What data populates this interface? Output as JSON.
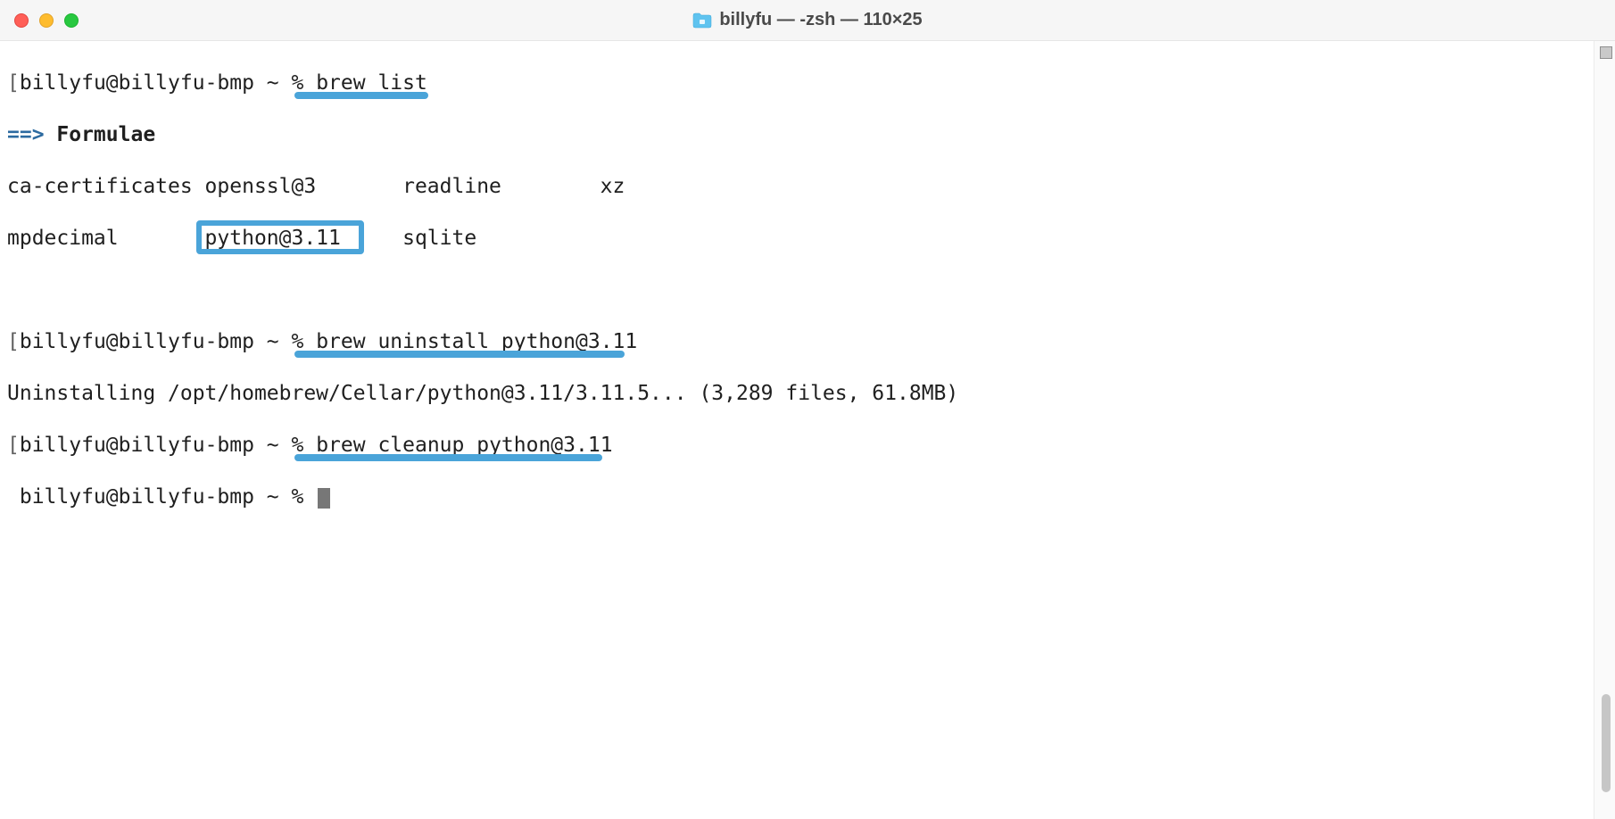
{
  "window": {
    "title": "billyfu — -zsh — 110×25",
    "traffic_lights": {
      "close": "close",
      "minimize": "minimize",
      "zoom": "zoom"
    }
  },
  "terminal": {
    "lines": {
      "l0": {
        "bracket": "[",
        "prompt": "billyfu@billyfu-bmp ~ % ",
        "cmd": "brew list",
        "end": "]"
      },
      "l1": {
        "arrow": "==>",
        "label": " Formulae"
      },
      "l2": {
        "text": "ca-certificates openssl@3       readline        xz"
      },
      "l3": {
        "text": "mpdecimal       python@3.11     sqlite"
      },
      "l4": {
        "text": ""
      },
      "l5": {
        "bracket": "[",
        "prompt": "billyfu@billyfu-bmp ~ % ",
        "cmd": "brew uninstall python@3.11",
        "end": "]"
      },
      "l6": {
        "text": "Uninstalling /opt/homebrew/Cellar/python@3.11/3.11.5... (3,289 files, 61.8MB)"
      },
      "l7": {
        "bracket": "[",
        "prompt": "billyfu@billyfu-bmp ~ % ",
        "cmd": "brew cleanup python@3.11",
        "end": "]"
      },
      "l8": {
        "prompt": " billyfu@billyfu-bmp ~ % "
      }
    }
  },
  "annotations": {
    "underline1_title": "brew list highlight",
    "box_title": "python@3.11 box highlight",
    "underline2_title": "brew uninstall python@3.11 highlight",
    "underline3_title": "brew cleanup python@3.11 highlight"
  }
}
